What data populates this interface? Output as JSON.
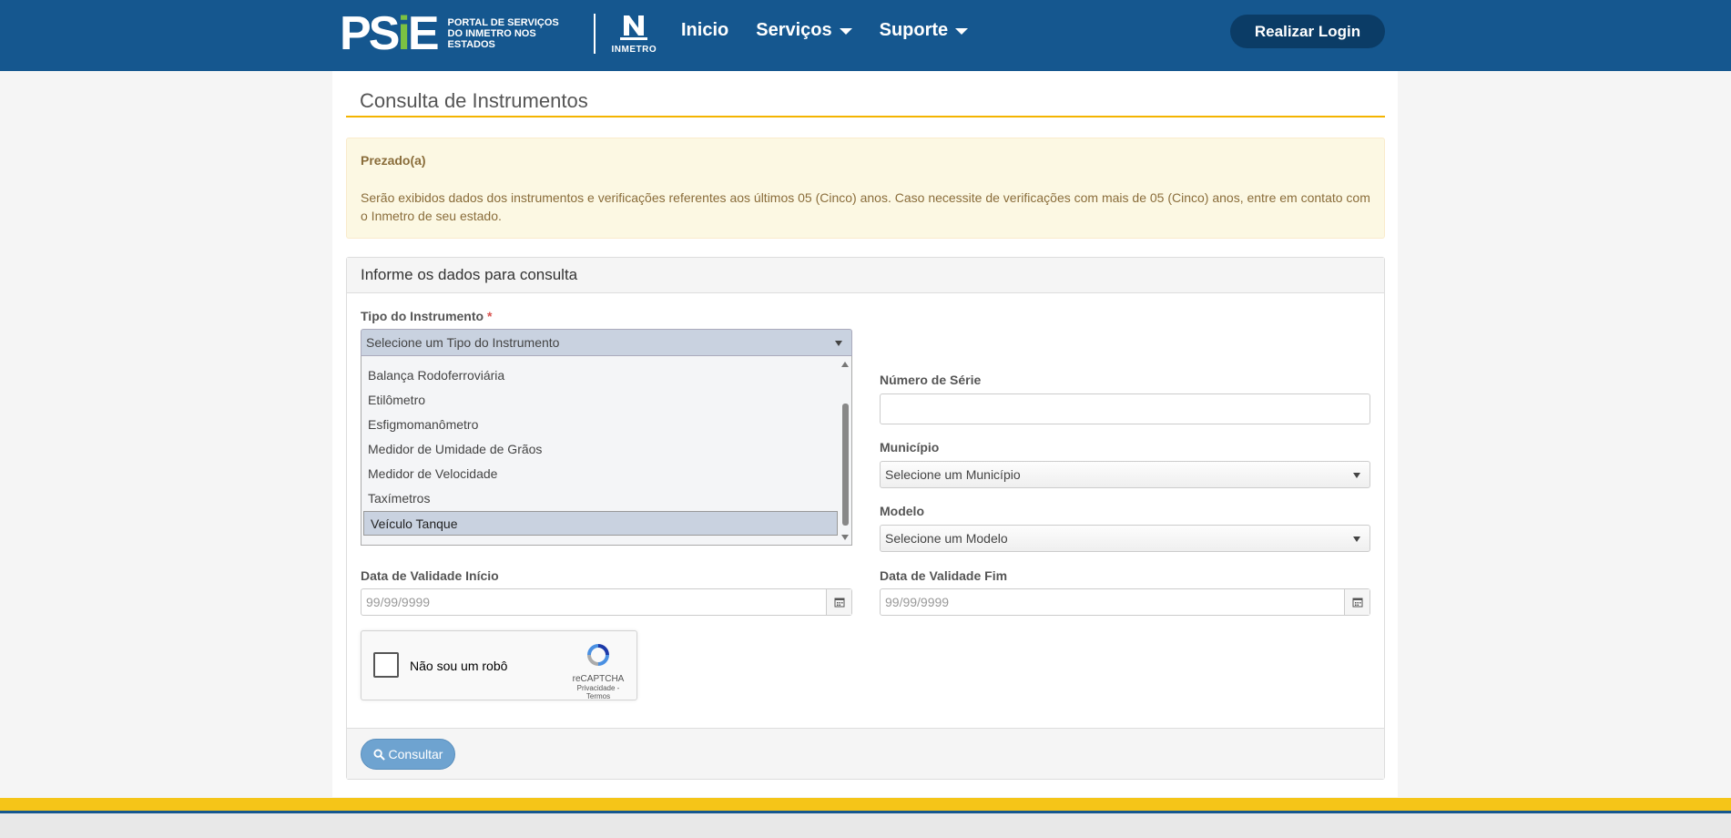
{
  "header": {
    "logo_psie": [
      "P",
      "S",
      "i",
      "E"
    ],
    "logo_text_line1": "PORTAL DE SERVIÇOS",
    "logo_text_line2": "DO INMETRO NOS ESTADOS",
    "inmetro_label": "INMETRO",
    "nav": [
      {
        "label": "Inicio"
      },
      {
        "label": "Serviços"
      },
      {
        "label": "Suporte"
      }
    ],
    "login_label": "Realizar Login"
  },
  "page": {
    "title": "Consulta de Instrumentos"
  },
  "alert": {
    "title": "Prezado(a)",
    "body": "Serão exibidos dados dos instrumentos e verificações referentes aos últimos 05 (Cinco) anos. Caso necessite de verificações com mais de 05 (Cinco) anos, entre em contato com o Inmetro de seu estado."
  },
  "form": {
    "heading": "Informe os dados para consulta",
    "tipo_label": "Tipo do Instrumento",
    "required_mark": "*",
    "tipo_selected": "Selecione um Tipo do Instrumento",
    "tipo_options": [
      "Balança Rodoferroviária",
      "Etilômetro",
      "Esfigmomanômetro",
      "Medidor de Umidade de Grãos",
      "Medidor de Velocidade",
      "Taxímetros",
      "Veículo Tanque"
    ],
    "tipo_highlighted": "Veículo Tanque",
    "numero_serie_label": "Número de Série",
    "numero_serie_value": "",
    "municipio_label": "Município",
    "municipio_selected": "Selecione um Município",
    "modelo_label": "Modelo",
    "modelo_selected": "Selecione um Modelo",
    "data_inicio_label": "Data de Validade Início",
    "data_inicio_placeholder": "99/99/9999",
    "data_fim_label": "Data de Validade Fim",
    "data_fim_placeholder": "99/99/9999",
    "captcha_label": "Não sou um robô",
    "captcha_brand": "reCAPTCHA",
    "captcha_links": "Privacidade - Termos",
    "submit_label": "Consultar"
  },
  "colors": {
    "header_bg": "#15578f",
    "accent_yellow": "#f4b400",
    "login_bg": "#0b3c66",
    "button_blue": "#6ea3d0"
  }
}
